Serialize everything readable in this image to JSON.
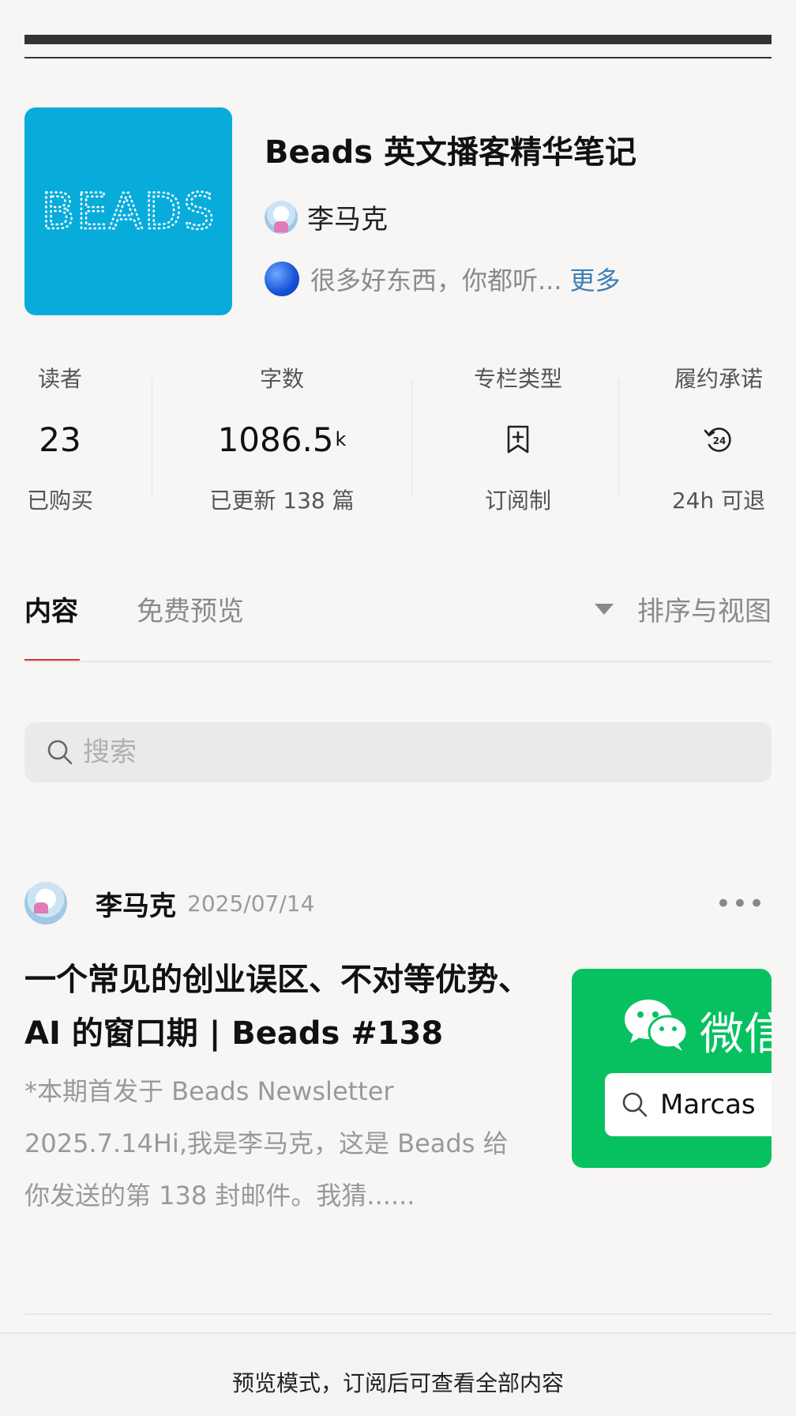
{
  "header": {
    "cover_text": "BEADS",
    "title": "Beads 英文播客精华笔记",
    "author": "李马克",
    "description": "很多好东西，你都听...",
    "more_label": "更多"
  },
  "stats": [
    {
      "label": "读者",
      "value": "23",
      "unit": "",
      "sub": "已购买"
    },
    {
      "label": "字数",
      "value": "1086.5",
      "unit": "k",
      "sub": "已更新 138 篇"
    },
    {
      "label": "专栏类型",
      "icon": "bookmark-plus-icon",
      "sub": "订阅制"
    },
    {
      "label": "履约承诺",
      "icon": "refund-24h-icon",
      "sub": "24h 可退"
    }
  ],
  "tabs": {
    "content": "内容",
    "free_preview": "免费预览",
    "sort_label": "排序与视图"
  },
  "search": {
    "placeholder": "搜索"
  },
  "post": {
    "author": "李马克",
    "date": "2025/07/14",
    "more": "•••",
    "title": "一个常见的创业误区、不对等优势、AI 的窗口期 | Beads #138",
    "excerpt": "*本期首发于 Beads Newsletter 2025.7.14Hi,我是李马克，这是 Beads 给你发送的第 138 封邮件。我猜......",
    "thumb_title": "微信",
    "thumb_search": "Marcas"
  },
  "footer": {
    "text": "预览模式，订阅后可查看全部内容"
  },
  "colors": {
    "accent": "#d33333",
    "link": "#3e7fb5",
    "cover": "#07acdb",
    "wechat_green": "#07c160"
  }
}
